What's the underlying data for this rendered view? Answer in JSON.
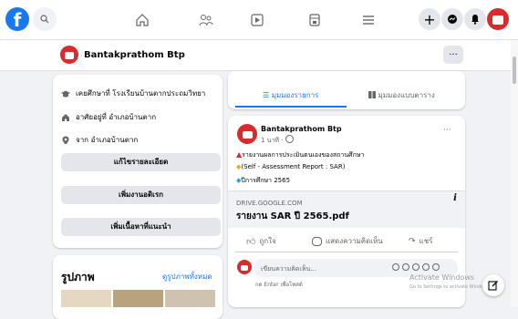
{
  "topbar": {
    "logo": "f",
    "nav_icons": [
      "home-icon",
      "friends-icon",
      "watch-icon",
      "marketplace-icon",
      "menu-icon"
    ],
    "right_buttons": [
      "create-icon",
      "messenger-icon",
      "notifications-icon"
    ]
  },
  "page_header": {
    "name": "Bantakprathom Btp",
    "more": "..."
  },
  "intro": {
    "rows": [
      {
        "icon": "education-icon",
        "text": "เคยศึกษาที่ โรงเรียนบ้านตากประถมวิทยา"
      },
      {
        "icon": "home-icon",
        "text": "อาศัยอยู่ที่ อำเภอบ้านตาก"
      },
      {
        "icon": "location-icon",
        "text": "จาก อำเภอบ้านตาก"
      }
    ],
    "buttons": [
      "แก้ไขรายละเอียด",
      "เพิ่มงานอดิเรก",
      "เพิ่มเนื้อหาที่แนะนำ"
    ]
  },
  "photos": {
    "title": "รูปภาพ",
    "see_all": "ดูรูปภาพทั้งหมด"
  },
  "feed_tabs": {
    "list_view": "☰ มุมมองรายการ",
    "grid_view": "มุมมองแบบตาราง"
  },
  "post": {
    "author": "Bantakprathom Btp",
    "meta": "1 นาที · ",
    "more": "···",
    "lines": [
      "รายงานผลการประเมินตนเองของสถานศึกษา",
      "(Self - Assessment Report : SAR)",
      "ปีการศึกษา   2565"
    ],
    "link_domain": "DRIVE.GOOGLE.COM",
    "link_title": "รายงาน SAR ปี 2565.pdf",
    "actions": [
      "ถูกใจ",
      "แสดงความคิดเห็น",
      "แชร์"
    ],
    "comment_placeholder": "เขียนความคิดเห็น...",
    "comment_hint": "กด Enter เพื่อโพสต์"
  },
  "watermark": {
    "line1": "Activate Windows",
    "line2": "Go to Settings to activate Windows."
  },
  "colors": {
    "brand": "#1877f2",
    "page_red": "#d92b2b",
    "bg": "#f0f2f5"
  }
}
